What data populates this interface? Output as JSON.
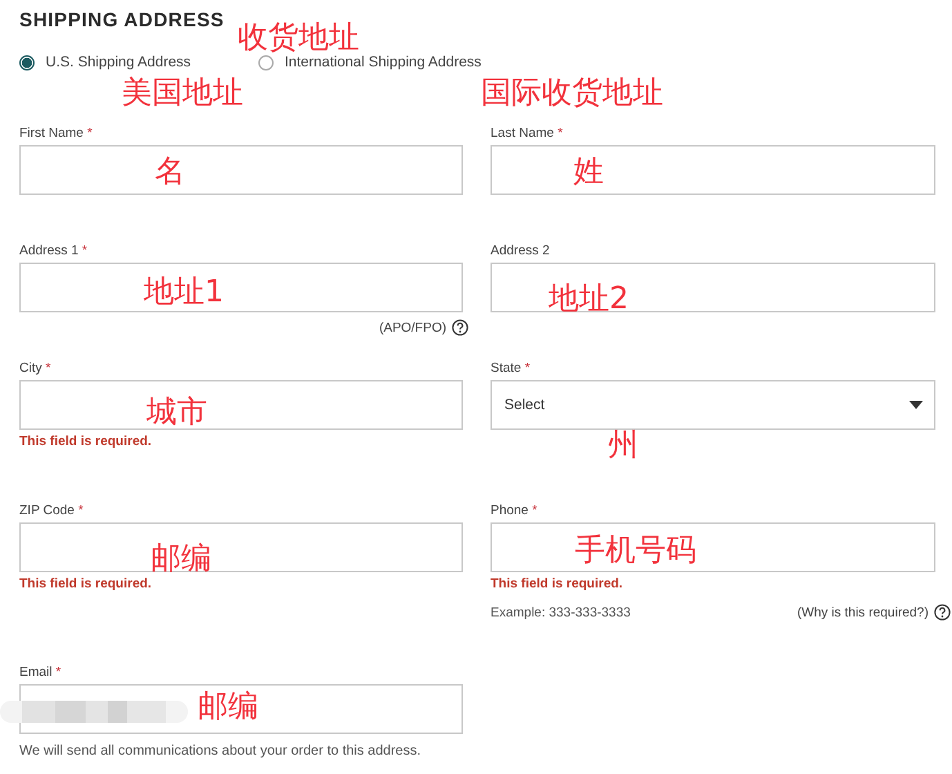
{
  "heading": {
    "title": "SHIPPING ADDRESS",
    "annotation": "收货地址"
  },
  "address_type": [
    {
      "label": "U.S. Shipping Address",
      "selected": true,
      "annotation": "美国地址"
    },
    {
      "label": "International Shipping Address",
      "selected": false,
      "annotation": "国际收货地址"
    }
  ],
  "rows": [
    [
      {
        "label": "First Name",
        "required_mark": "*",
        "kind": "text",
        "annotation": "名"
      },
      {
        "label": "Last Name",
        "required_mark": "*",
        "kind": "text",
        "annotation": "姓"
      }
    ],
    [
      {
        "label": "Address 1",
        "required_mark": "*",
        "kind": "text",
        "annotation": "地址1",
        "help": "(APO/FPO)"
      },
      {
        "label": "Address 2",
        "kind": "text",
        "annotation": "地址2"
      }
    ],
    [
      {
        "label": "City",
        "required_mark": "*",
        "kind": "text",
        "annotation": "城市",
        "error": "This field is required."
      },
      {
        "label": "State",
        "required_mark": "*",
        "kind": "select",
        "value": "Select",
        "annotation": "州"
      }
    ],
    [
      {
        "label": "ZIP Code",
        "required_mark": "*",
        "kind": "text",
        "annotation": "邮编",
        "error": "This field is required."
      },
      {
        "label": "Phone",
        "required_mark": "*",
        "kind": "text",
        "annotation": "手机号码",
        "error": "This field is required.",
        "hint": "Example: 333-333-3333",
        "help": "(Why is this required?)"
      }
    ],
    [
      {
        "label": "Email",
        "required_mark": "*",
        "kind": "text",
        "annotation": "邮编",
        "redacted": true,
        "note": "We will send all communications about your order to this address."
      }
    ]
  ]
}
